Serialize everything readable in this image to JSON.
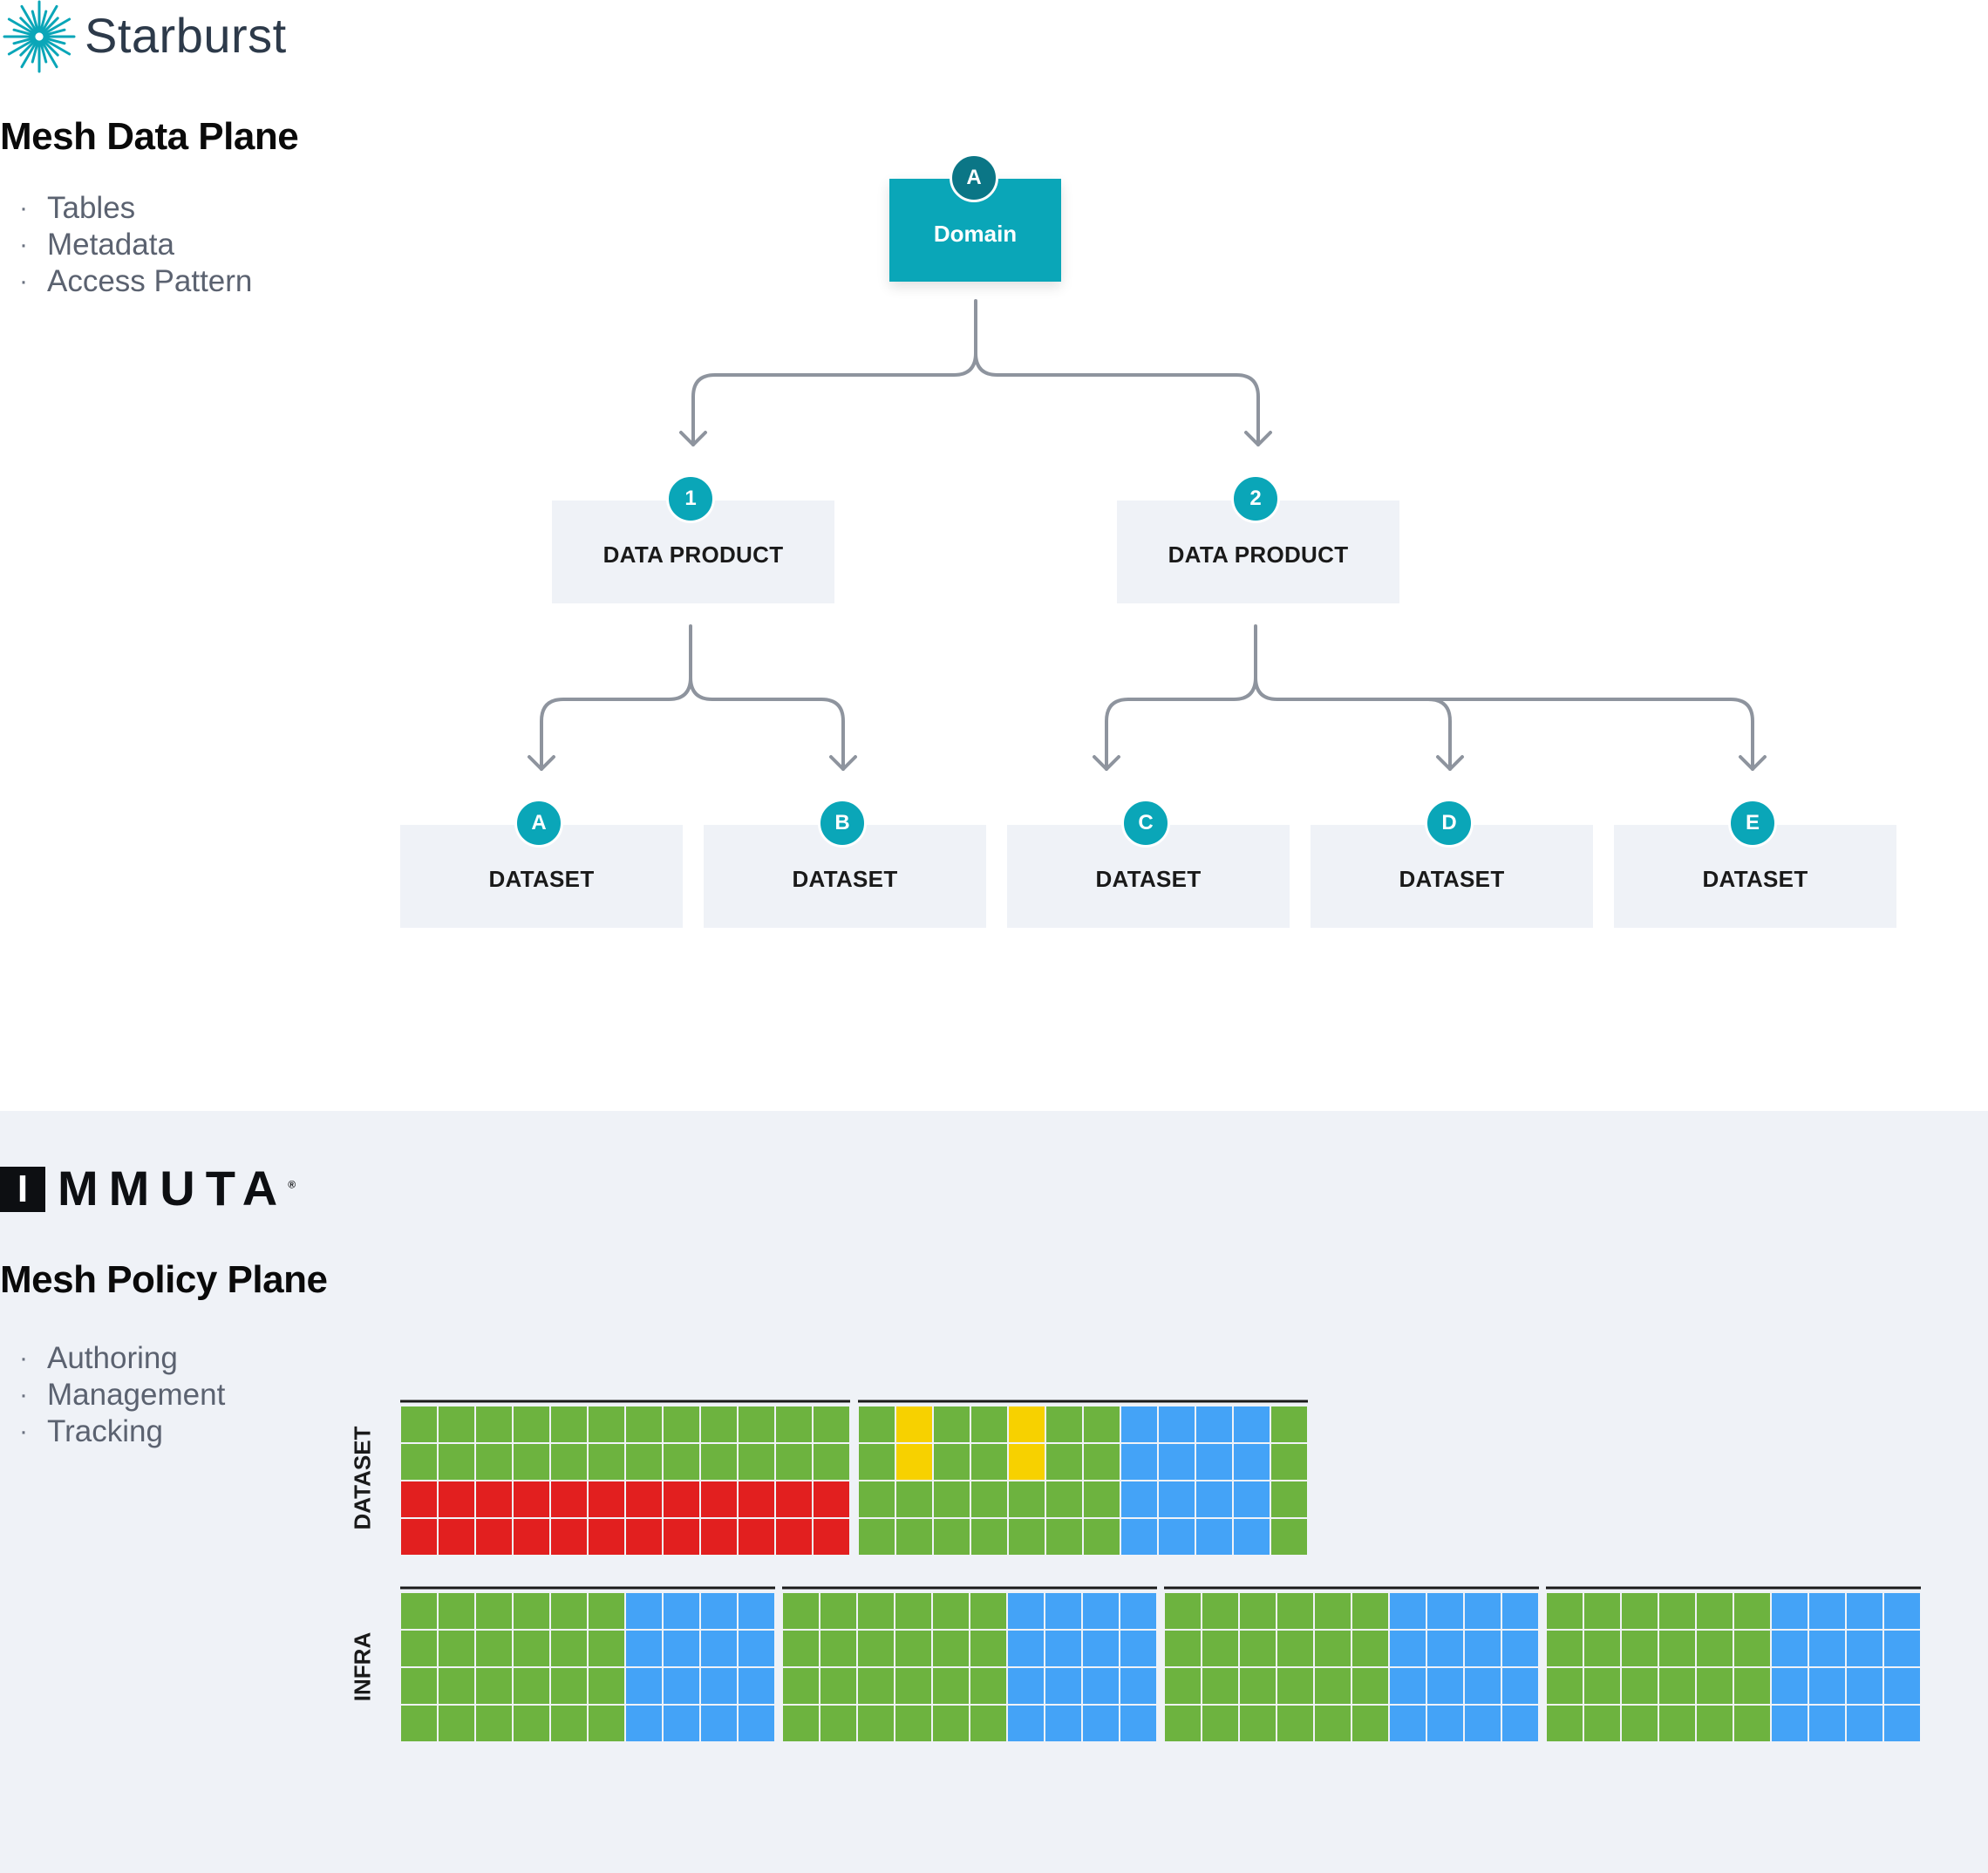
{
  "brand_top": {
    "name": "Starburst",
    "logo": "starburst-burst-icon",
    "color": "#0aa6b8"
  },
  "data_plane": {
    "title": "Mesh Data Plane",
    "bullets": [
      "Tables",
      "Metadata",
      "Access Pattern"
    ]
  },
  "tree": {
    "domain": {
      "badge": "A",
      "label": "Domain"
    },
    "products": [
      {
        "badge": "1",
        "label": "DATA PRODUCT"
      },
      {
        "badge": "2",
        "label": "DATA PRODUCT"
      }
    ],
    "datasets": [
      {
        "badge": "A",
        "label": "DATASET",
        "parent": 0
      },
      {
        "badge": "B",
        "label": "DATASET",
        "parent": 0
      },
      {
        "badge": "C",
        "label": "DATASET",
        "parent": 1
      },
      {
        "badge": "D",
        "label": "DATASET",
        "parent": 1
      },
      {
        "badge": "E",
        "label": "DATASET",
        "parent": 1
      }
    ]
  },
  "brand_bottom": {
    "mark": "I",
    "name": "MMUTA",
    "reg": "®"
  },
  "policy_plane": {
    "title": "Mesh Policy Plane",
    "bullets": [
      "Authoring",
      "Management",
      "Tracking"
    ]
  },
  "colors": {
    "green": "#6db33f",
    "red": "#e21f1f",
    "yellow": "#f7d100",
    "blue": "#44a3f7",
    "teal": "#0aa6b8",
    "teal_dark": "#0b7686"
  },
  "grids": {
    "dataset_label": "DATASET",
    "infra_label": "INFRA",
    "dataset": [
      {
        "rows": [
          "GGGGGGGGGGGG",
          "GGGGGGGGGGGG",
          "RRRRRRRRRRRR",
          "RRRRRRRRRRRR"
        ]
      },
      {
        "rows": [
          "GYGGYGGBBBBG",
          "GYGGYGGBBBBG",
          "GGGGGGGBBBBG",
          "GGGGGGGBBBBG"
        ]
      }
    ],
    "infra": [
      {
        "rows": [
          "GGGGGGBBBB",
          "GGGGGGBBBB",
          "GGGGGGBBBB",
          "GGGGGGBBBB"
        ]
      },
      {
        "rows": [
          "GGGGGGBBBB",
          "GGGGGGBBBB",
          "GGGGGGBBBB",
          "GGGGGGBBBB"
        ]
      },
      {
        "rows": [
          "GGGGGGBBBB",
          "GGGGGGBBBB",
          "GGGGGGBBBB",
          "GGGGGGBBBB"
        ]
      },
      {
        "rows": [
          "GGGGGGBBBB",
          "GGGGGGBBBB",
          "GGGGGGBBBB",
          "GGGGGGBBBB"
        ]
      }
    ]
  }
}
